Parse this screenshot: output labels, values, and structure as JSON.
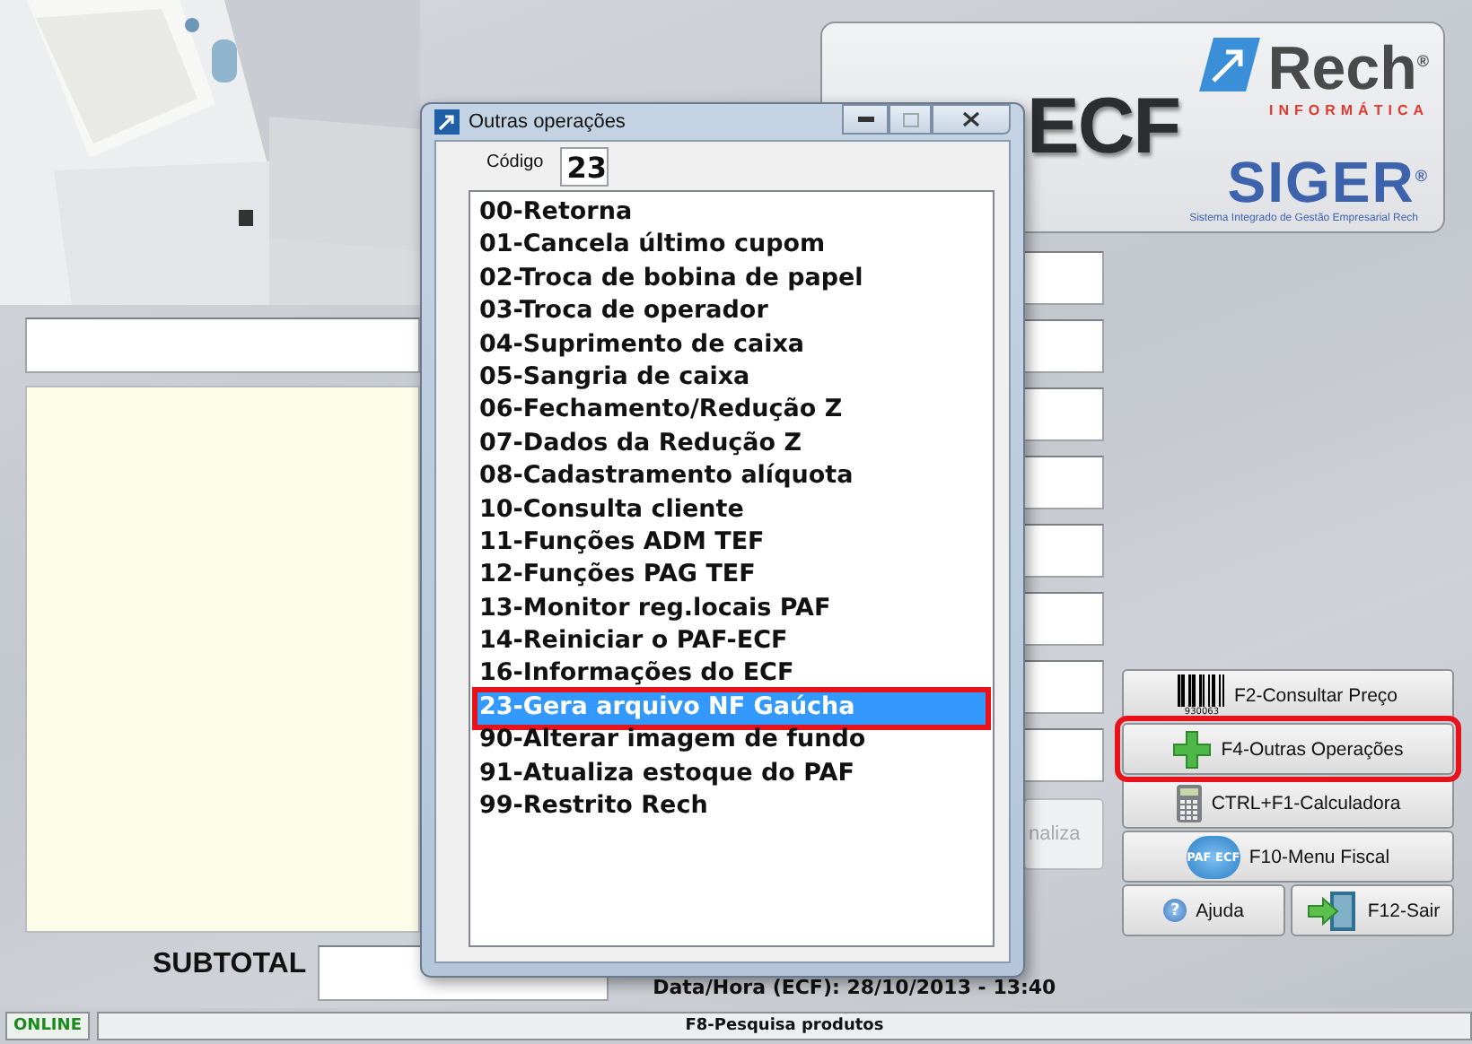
{
  "status_bar": {
    "connection": "ONLINE",
    "hint": "F8-Pesquisa produtos"
  },
  "logo": {
    "product": "ECF",
    "brand": "Rech$^{®}$",
    "brand_sub": "INFORMÁTICA",
    "system": "SIGER$^{®}$",
    "system_sub": "Sistema Integrado de Gestão Empresarial Rech"
  },
  "side_button": {
    "label": "naliza"
  },
  "subtotal": {
    "label": "SUBTOTAL"
  },
  "date_time": "Data/Hora (ECF): 28/10/2013 - 13:40",
  "button_rows": [
    [
      {
        "kind": "barcode",
        "label": "F2-Consultar Preço",
        "icon_text": "930063",
        "highlighted": false
      }
    ],
    [
      {
        "kind": "plus",
        "label": "F4-Outras Operações",
        "highlighted": true
      }
    ],
    [
      {
        "kind": "calculator",
        "label": "CTRL+F1-Calculadora",
        "highlighted": false
      }
    ],
    [
      {
        "kind": "paf",
        "label": "F10-Menu Fiscal",
        "icon_text": "PAF ECF",
        "highlighted": false
      }
    ],
    [
      {
        "kind": "help",
        "label": "Ajuda",
        "icon_text": "?",
        "highlighted": false
      },
      {
        "kind": "exit",
        "label": "F12-Sair",
        "highlighted": false
      }
    ]
  ],
  "dialog": {
    "title": "Outras operações",
    "code_label": "Código",
    "code_value": "23",
    "items": [
      {
        "label": "00-Retorna",
        "selected": false,
        "highlighted": false
      },
      {
        "label": "01-Cancela último cupom",
        "selected": false,
        "highlighted": false
      },
      {
        "label": "02-Troca de bobina de papel",
        "selected": false,
        "highlighted": false
      },
      {
        "label": "03-Troca de operador",
        "selected": false,
        "highlighted": false
      },
      {
        "label": "04-Suprimento de caixa",
        "selected": false,
        "highlighted": false
      },
      {
        "label": "05-Sangria de caixa",
        "selected": false,
        "highlighted": false
      },
      {
        "label": "06-Fechamento/Redução Z",
        "selected": false,
        "highlighted": false
      },
      {
        "label": "07-Dados da Redução Z",
        "selected": false,
        "highlighted": false
      },
      {
        "label": "08-Cadastramento alíquota",
        "selected": false,
        "highlighted": false
      },
      {
        "label": "10-Consulta cliente",
        "selected": false,
        "highlighted": false
      },
      {
        "label": "11-Funções ADM TEF",
        "selected": false,
        "highlighted": false
      },
      {
        "label": "12-Funções PAG TEF",
        "selected": false,
        "highlighted": false
      },
      {
        "label": "13-Monitor reg.locais PAF",
        "selected": false,
        "highlighted": false
      },
      {
        "label": "14-Reiniciar o PAF-ECF",
        "selected": false,
        "highlighted": false
      },
      {
        "label": "16-Informações do ECF",
        "selected": false,
        "highlighted": false
      },
      {
        "label": "23-Gera arquivo NF Gaúcha",
        "selected": true,
        "highlighted": true
      },
      {
        "label": "90-Alterar imagem de fundo",
        "selected": false,
        "highlighted": false
      },
      {
        "label": "91-Atualiza estoque do PAF",
        "selected": false,
        "highlighted": false
      },
      {
        "label": "99-Restrito Rech",
        "selected": false,
        "highlighted": false
      }
    ]
  }
}
